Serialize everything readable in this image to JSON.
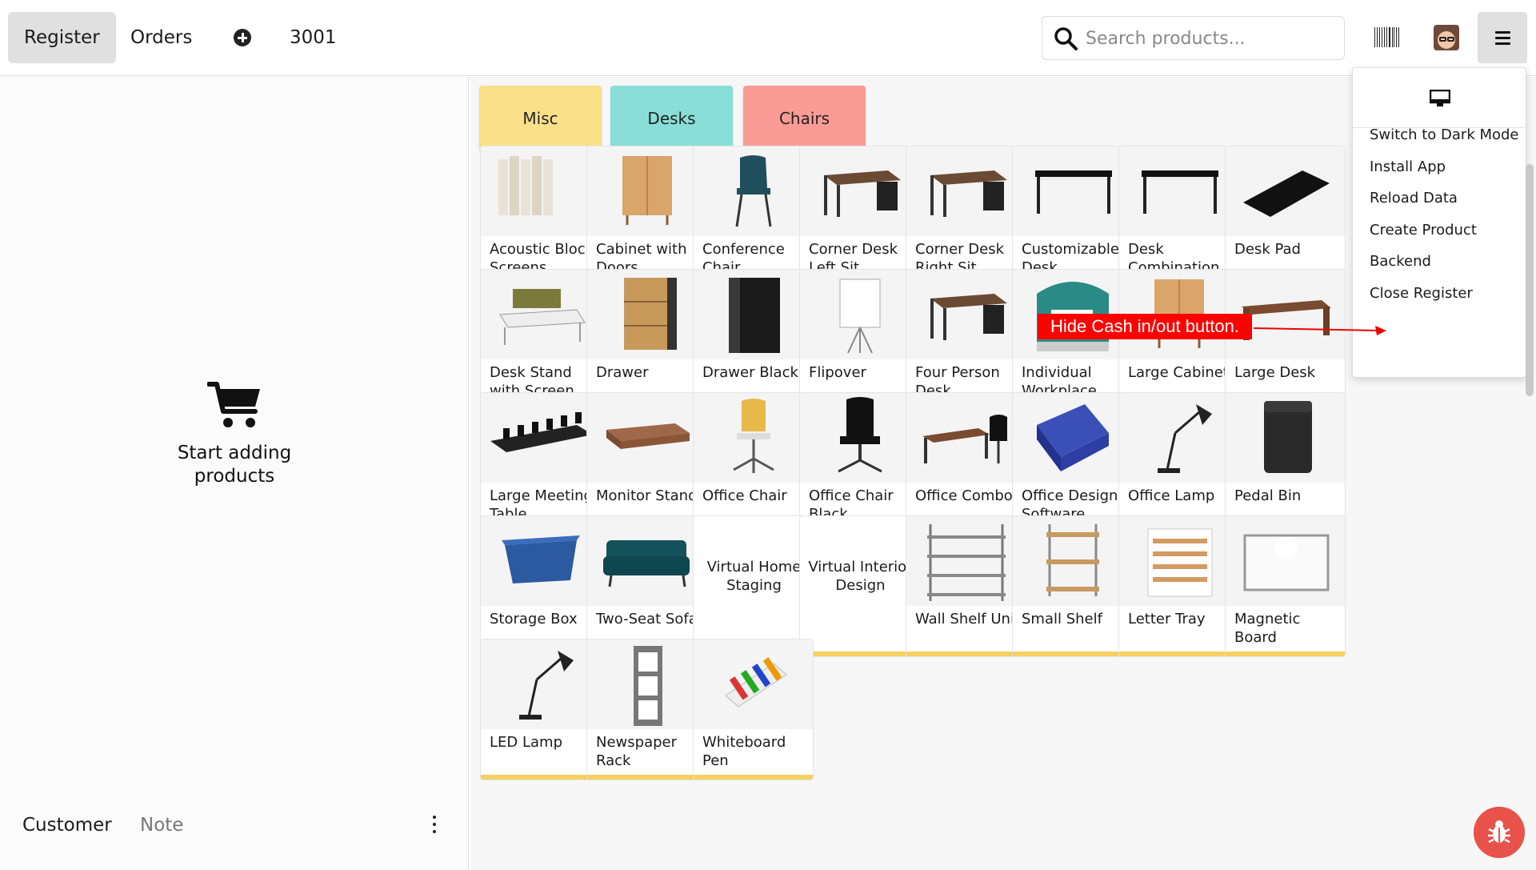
{
  "navbar": {
    "register_label": "Register",
    "orders_label": "Orders",
    "order_number": "3001",
    "search_placeholder": "Search products..."
  },
  "order_panel": {
    "empty_text": "Start adding products",
    "customer_label": "Customer",
    "note_label": "Note"
  },
  "categories": [
    {
      "label": "Misc",
      "color": "#fbe08a"
    },
    {
      "label": "Desks",
      "color": "#89dfd8"
    },
    {
      "label": "Chairs",
      "color": "#fa9b95"
    }
  ],
  "colors": {
    "misc": "#f5d060",
    "desks": "#6fcfc4",
    "chairs": "#f06b6b",
    "annotation": "#ff0000"
  },
  "products": [
    {
      "name": "Acoustic Bloc Screens",
      "category": "misc",
      "icon": "screens"
    },
    {
      "name": "Cabinet with Doors",
      "category": "misc",
      "icon": "cabinet"
    },
    {
      "name": "Conference Chair",
      "category": "chairs",
      "icon": "chair"
    },
    {
      "name": "Corner Desk Left Sit",
      "category": "desks",
      "icon": "desk"
    },
    {
      "name": "Corner Desk Right Sit",
      "category": "desks",
      "icon": "desk"
    },
    {
      "name": "Customizable Desk",
      "category": "desks",
      "icon": "desk-white"
    },
    {
      "name": "Desk Combination",
      "category": "desks",
      "icon": "desk-white"
    },
    {
      "name": "Desk Pad",
      "category": "misc",
      "icon": "pad"
    },
    {
      "name": "Desk Stand with Screen",
      "category": "misc",
      "icon": "stand"
    },
    {
      "name": "Drawer",
      "category": "misc",
      "icon": "drawer"
    },
    {
      "name": "Drawer Black",
      "category": "misc",
      "icon": "drawer-black"
    },
    {
      "name": "Flipover",
      "category": "misc",
      "icon": "flipover"
    },
    {
      "name": "Four Person Desk",
      "category": "desks",
      "icon": "desk"
    },
    {
      "name": "Individual Workplace",
      "category": "desks",
      "icon": "workplace"
    },
    {
      "name": "Large Cabinet",
      "category": "misc",
      "icon": "cabinet"
    },
    {
      "name": "Large Desk",
      "category": "desks",
      "icon": "desk-wood"
    },
    {
      "name": "Large Meeting Table",
      "category": "misc",
      "icon": "meeting"
    },
    {
      "name": "Monitor Stand",
      "category": "misc",
      "icon": "monitor-stand"
    },
    {
      "name": "Office Chair",
      "category": "chairs",
      "icon": "office-chair"
    },
    {
      "name": "Office Chair Black",
      "category": "chairs",
      "icon": "office-chair-black"
    },
    {
      "name": "Office Combo",
      "category": "misc",
      "icon": "combo"
    },
    {
      "name": "Office Design Software",
      "category": "misc",
      "icon": "software"
    },
    {
      "name": "Office Lamp",
      "category": "misc",
      "icon": "lamp"
    },
    {
      "name": "Pedal Bin",
      "category": "misc",
      "icon": "bin"
    },
    {
      "name": "Storage Box",
      "category": "misc",
      "icon": "box"
    },
    {
      "name": "Two-Seat Sofa",
      "category": "misc",
      "icon": "sofa"
    },
    {
      "name": "Virtual Home Staging",
      "category": "misc",
      "icon": ""
    },
    {
      "name": "Virtual Interior Design",
      "category": "misc",
      "icon": ""
    },
    {
      "name": "Wall Shelf Unit",
      "category": "misc",
      "icon": "shelf"
    },
    {
      "name": "Small Shelf",
      "category": "misc",
      "icon": "small-shelf"
    },
    {
      "name": "Letter Tray",
      "category": "misc",
      "icon": "tray"
    },
    {
      "name": "Magnetic Board",
      "category": "misc",
      "icon": "board"
    },
    {
      "name": "LED Lamp",
      "category": "misc",
      "icon": "lamp"
    },
    {
      "name": "Newspaper Rack",
      "category": "misc",
      "icon": "rack"
    },
    {
      "name": "Whiteboard Pen",
      "category": "misc",
      "icon": "pens"
    }
  ],
  "menu": {
    "items": [
      "Switch to Dark Mode",
      "Install App",
      "Reload Data",
      "Create Product",
      "Backend",
      "Close Register"
    ]
  },
  "annotation": {
    "text": "Hide Cash in/out button."
  }
}
